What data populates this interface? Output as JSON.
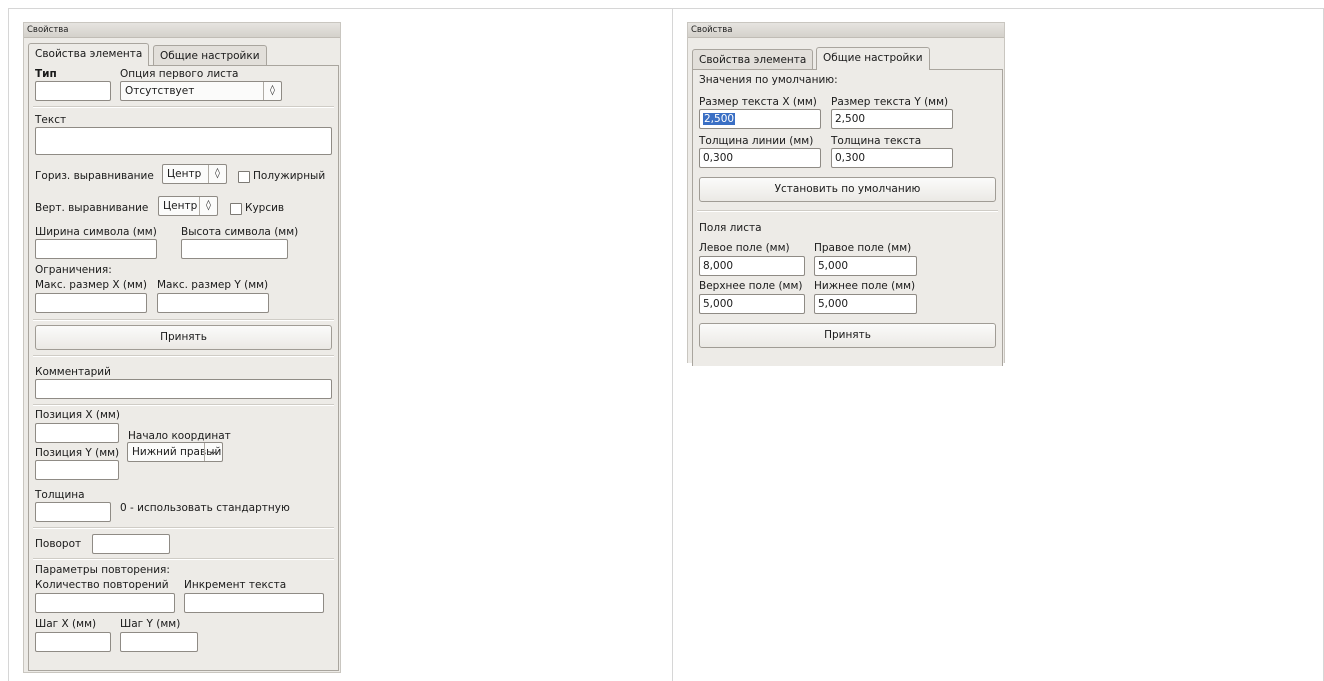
{
  "left_panel": {
    "title": "Свойства",
    "tabs": [
      {
        "label": "Свойства элемента",
        "active": true
      },
      {
        "label": "Общие настройки",
        "active": false
      }
    ],
    "type_label": "Тип",
    "first_sheet_option_label": "Опция первого листа",
    "first_sheet_option_value": "Отсутствует",
    "text_label": "Текст",
    "horiz_align_label": "Гориз. выравнивание",
    "horiz_align_value": "Центр",
    "bold_label": "Полужирный",
    "vert_align_label": "Верт. выравнивание",
    "vert_align_value": "Центр",
    "italic_label": "Курсив",
    "char_width_label": "Ширина символа (мм)",
    "char_height_label": "Высота символа (мм)",
    "limits_label": "Ограничения:",
    "max_x_label": "Макс. размер X (мм)",
    "max_y_label": "Макс. размер Y (мм)",
    "accept_button": "Принять",
    "comment_label": "Комментарий",
    "pos_x_label": "Позиция X (мм)",
    "origin_label": "Начало координат",
    "pos_y_label": "Позиция Y (мм)",
    "origin_value": "Нижний правый",
    "thickness_label": "Толщина",
    "thickness_hint": "0 - использовать стандартную",
    "rotation_label": "Поворот",
    "repeat_params_label": "Параметры повторения:",
    "repeat_count_label": "Количество повторений",
    "text_increment_label": "Инкремент текста",
    "step_x_label": "Шаг X (мм)",
    "step_y_label": "Шаг Y (мм)"
  },
  "right_panel": {
    "title": "Свойства",
    "tabs": [
      {
        "label": "Свойства элемента",
        "active": false
      },
      {
        "label": "Общие настройки",
        "active": true
      }
    ],
    "defaults_label": "Значения по умолчанию:",
    "text_size_x_label": "Размер текста X (мм)",
    "text_size_y_label": "Размер текста Y (мм)",
    "text_size_x_value": "2,500",
    "text_size_y_value": "2,500",
    "line_thickness_label": "Толщина линии (мм)",
    "text_thickness_label": "Толщина текста",
    "line_thickness_value": "0,300",
    "text_thickness_value": "0,300",
    "set_defaults_button": "Установить по умолчанию",
    "margins_label": "Поля листа",
    "left_margin_label": "Левое поле (мм)",
    "right_margin_label": "Правое поле (мм)",
    "left_margin_value": "8,000",
    "right_margin_value": "5,000",
    "top_margin_label": "Верхнее поле (мм)",
    "bottom_margin_label": "Нижнее поле (мм)",
    "top_margin_value": "5,000",
    "bottom_margin_value": "5,000",
    "accept_button": "Принять"
  }
}
